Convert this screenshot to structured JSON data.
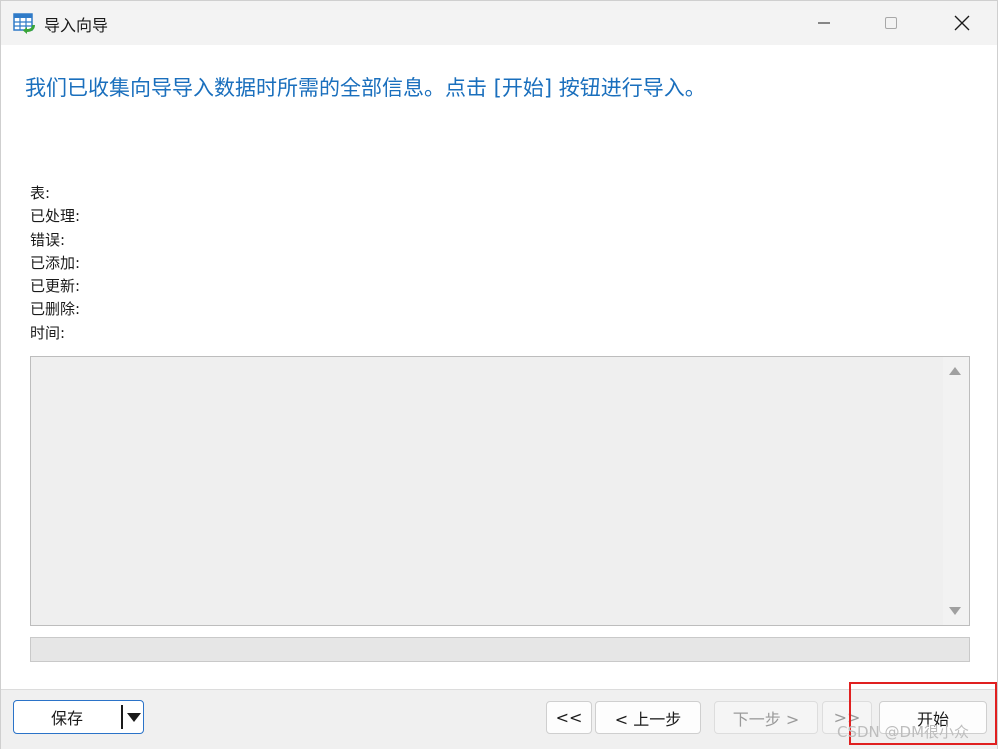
{
  "window": {
    "title": "导入向导",
    "icon": "table-import-icon"
  },
  "headline": "我们已收集向导导入数据时所需的全部信息。点击 [开始] 按钮进行导入。",
  "info": [
    {
      "label": "表:",
      "value": ""
    },
    {
      "label": "已处理:",
      "value": ""
    },
    {
      "label": "错误:",
      "value": ""
    },
    {
      "label": "已添加:",
      "value": ""
    },
    {
      "label": "已更新:",
      "value": ""
    },
    {
      "label": "已删除:",
      "value": ""
    },
    {
      "label": "时间:",
      "value": ""
    }
  ],
  "log": {
    "text": ""
  },
  "progress": {
    "percent": 0
  },
  "footer": {
    "save_label": "保存",
    "first_label": "<<",
    "prev_label": "< 上一步",
    "next_label": "下一步 >",
    "last_label": ">>",
    "start_label": "开始"
  },
  "watermark": "CSDN @DM很小众",
  "colors": {
    "headline": "#1a6fbd",
    "highlight": "#e02020",
    "save_border": "#2b73c8"
  }
}
